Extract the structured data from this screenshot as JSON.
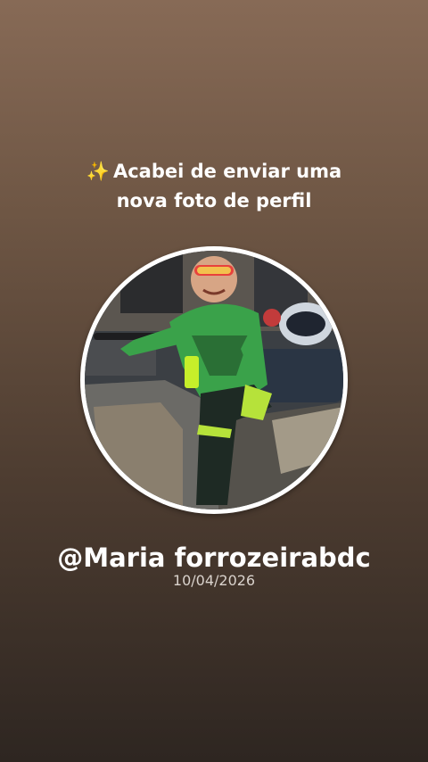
{
  "header": {
    "icon": "sparkles-icon",
    "icon_glyph": "✨",
    "line1": "Acabei de enviar uma",
    "line2": "nova foto de perfil"
  },
  "profile": {
    "username": "@Maria forrozeirabdc",
    "date": "10/04/2026"
  },
  "colors": {
    "background_top": "#876a56",
    "background_bottom": "#2e2621",
    "text": "#ffffff",
    "date_text": "#d9d2cc"
  }
}
